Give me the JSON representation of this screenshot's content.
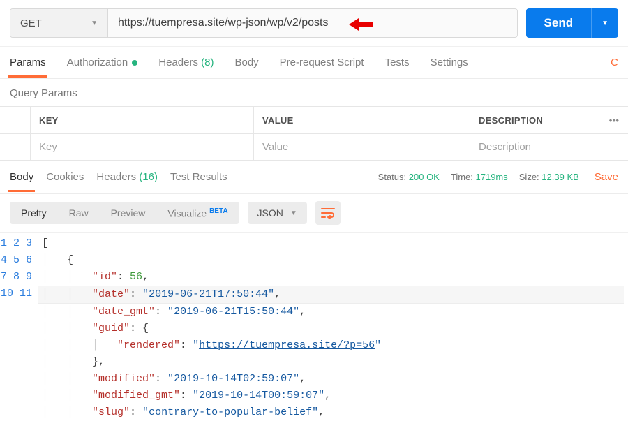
{
  "request": {
    "method": "GET",
    "url": "https://tuempresa.site/wp-json/wp/v2/posts",
    "send_label": "Send"
  },
  "req_tabs": {
    "params": "Params",
    "authorization": "Authorization",
    "headers": "Headers",
    "headers_count": "(8)",
    "body": "Body",
    "prerequest": "Pre-request Script",
    "tests": "Tests",
    "settings": "Settings",
    "cookies_link": "C"
  },
  "query_params": {
    "heading": "Query Params",
    "col_key": "KEY",
    "col_value": "VALUE",
    "col_desc": "DESCRIPTION",
    "more": "•••",
    "placeholder_key": "Key",
    "placeholder_value": "Value",
    "placeholder_desc": "Description"
  },
  "resp_tabs": {
    "body": "Body",
    "cookies": "Cookies",
    "headers": "Headers",
    "headers_count": "(16)",
    "tests": "Test Results"
  },
  "status": {
    "status_label": "Status:",
    "status_value": "200 OK",
    "time_label": "Time:",
    "time_value": "1719ms",
    "size_label": "Size:",
    "size_value": "12.39 KB",
    "save": "Save"
  },
  "view": {
    "pretty": "Pretty",
    "raw": "Raw",
    "preview": "Preview",
    "visualize": "Visualize",
    "beta": "BETA",
    "format": "JSON"
  },
  "json_body": {
    "id": 56,
    "date": "2019-06-21T17:50:44",
    "date_gmt": "2019-06-21T15:50:44",
    "guid_rendered": "https://tuempresa.site/?p=56",
    "modified": "2019-10-14T02:59:07",
    "modified_gmt": "2019-10-14T00:59:07",
    "slug": "contrary-to-popular-belief"
  },
  "chart_data": null
}
